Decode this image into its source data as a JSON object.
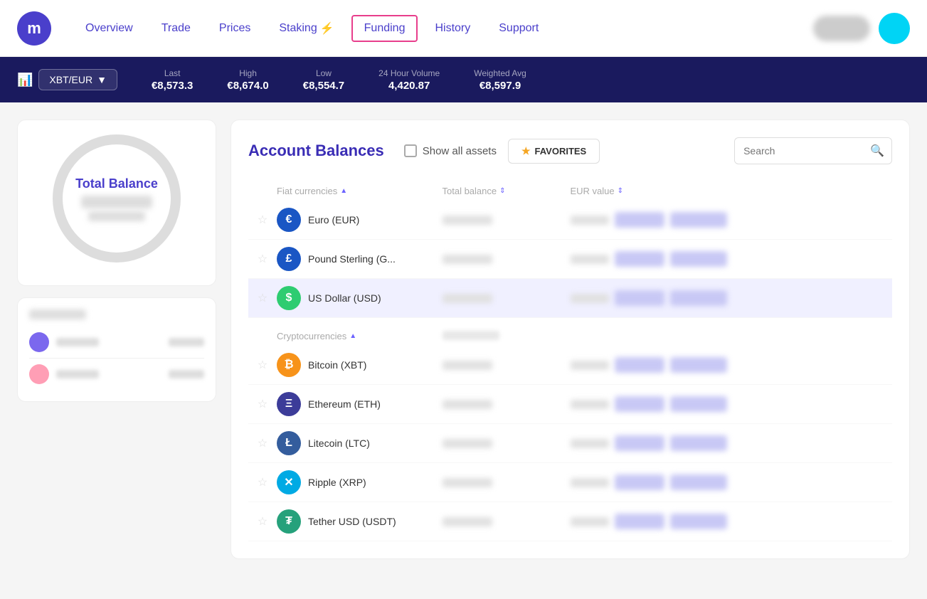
{
  "nav": {
    "logo_text": "m",
    "links": [
      {
        "label": "Overview",
        "active": false
      },
      {
        "label": "Trade",
        "active": false
      },
      {
        "label": "Prices",
        "active": false
      },
      {
        "label": "Staking",
        "active": false,
        "badge": "⚡"
      },
      {
        "label": "Funding",
        "active": true
      },
      {
        "label": "History",
        "active": false
      },
      {
        "label": "Support",
        "active": false
      }
    ]
  },
  "ticker": {
    "pair": "XBT/EUR",
    "stats": [
      {
        "label": "Last",
        "value": "€8,573.3"
      },
      {
        "label": "High",
        "value": "€8,674.0"
      },
      {
        "label": "Low",
        "value": "€8,554.7"
      },
      {
        "label": "24 Hour Volume",
        "value": "4,420.87"
      },
      {
        "label": "Weighted Avg",
        "value": "€8,597.9"
      }
    ]
  },
  "left_panel": {
    "total_balance_label": "Total Balance"
  },
  "balances": {
    "title": "Account Balances",
    "show_all_label": "Show all assets",
    "favorites_label": "FAVORITES",
    "search_placeholder": "Search",
    "fiat_section_label": "Fiat currencies",
    "crypto_section_label": "Cryptocurrencies",
    "col_total_balance": "Total balance",
    "col_eur_value": "EUR value",
    "currencies": [
      {
        "id": "eur",
        "symbol": "€",
        "name": "Euro (EUR)",
        "icon_class": "eur"
      },
      {
        "id": "gbp",
        "symbol": "£",
        "name": "Pound Sterling (G...",
        "icon_class": "gbp"
      },
      {
        "id": "usd",
        "symbol": "$",
        "name": "US Dollar (USD)",
        "icon_class": "usd"
      }
    ],
    "cryptos": [
      {
        "id": "btc",
        "symbol": "₿",
        "name": "Bitcoin (XBT)",
        "icon_class": "btc"
      },
      {
        "id": "eth",
        "symbol": "Ξ",
        "name": "Ethereum (ETH)",
        "icon_class": "eth"
      },
      {
        "id": "ltc",
        "symbol": "Ł",
        "name": "Litecoin (LTC)",
        "icon_class": "ltc"
      },
      {
        "id": "xrp",
        "symbol": "✕",
        "name": "Ripple (XRP)",
        "icon_class": "xrp"
      },
      {
        "id": "usdt",
        "symbol": "₮",
        "name": "Tether USD (USDT)",
        "icon_class": "usdt"
      }
    ]
  }
}
